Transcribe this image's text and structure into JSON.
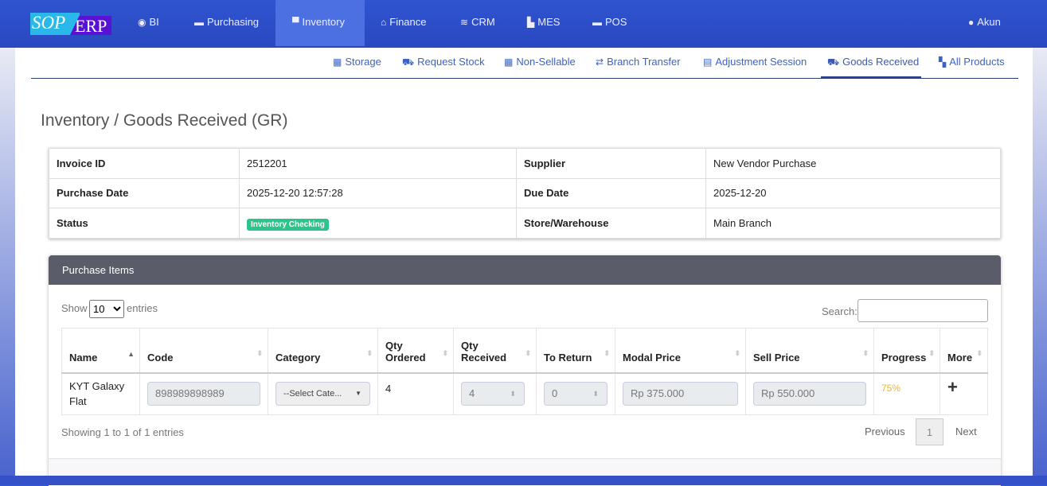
{
  "brand": {
    "part1": "SOP",
    "part2": "ERP"
  },
  "nav": [
    {
      "label": "BI",
      "icon": "dashboard-icon"
    },
    {
      "label": "Purchasing",
      "icon": "store-icon"
    },
    {
      "label": "Inventory",
      "icon": "box-icon"
    },
    {
      "label": "Finance",
      "icon": "bank-icon"
    },
    {
      "label": "CRM",
      "icon": "layers-icon"
    },
    {
      "label": "MES",
      "icon": "industry-icon"
    },
    {
      "label": "POS",
      "icon": "register-icon"
    }
  ],
  "account": "Akun",
  "subnav": [
    "Storage",
    "Request Stock",
    "Non-Sellable",
    "Branch Transfer",
    "Adjustment Session",
    "Goods Received",
    "All Products"
  ],
  "title": "Inventory / Goods Received (GR)",
  "info": {
    "invoice_id_label": "Invoice ID",
    "invoice_id": "2512201",
    "supplier_label": "Supplier",
    "supplier": "New Vendor Purchase",
    "purchase_date_label": "Purchase Date",
    "purchase_date": "2025-12-20 12:57:28",
    "due_date_label": "Due Date",
    "due_date": "2025-12-20",
    "status_label": "Status",
    "status": "Inventory Checking",
    "store_label": "Store/Warehouse",
    "store": "Main Branch"
  },
  "card": {
    "title": "Purchase Items",
    "show": "Show",
    "entries": "entries",
    "length": "10",
    "search": "Search:",
    "columns": [
      "Name",
      "Code",
      "Category",
      "Qty Ordered",
      "Qty Received",
      "To Return",
      "Modal Price",
      "Sell Price",
      "Progress",
      "More"
    ],
    "row": {
      "name": "KYT Galaxy Flat",
      "code": "898989898989",
      "category": "--Select Cate...",
      "qty_ordered": "4",
      "qty_received": "4",
      "to_return": "0",
      "modal_price": "Rp 375.000",
      "sell_price": "Rp 550.000",
      "progress": "75%"
    },
    "info_text": "Showing 1 to 1 of 1 entries",
    "prev": "Previous",
    "page": "1",
    "next": "Next"
  }
}
